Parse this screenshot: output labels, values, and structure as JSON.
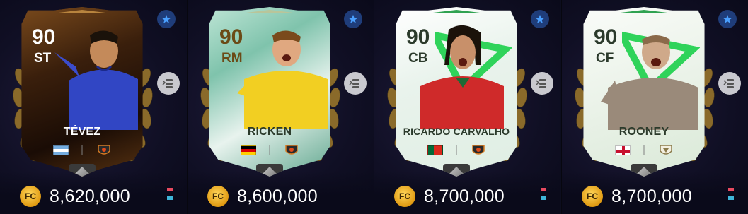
{
  "cards": [
    {
      "id": "tevez",
      "rating": "90",
      "position": "ST",
      "name": "TÉVEZ",
      "flag": "argentina",
      "club_badge": "club-badge-icon",
      "price": "8,620,000"
    },
    {
      "id": "ricken",
      "rating": "90",
      "position": "RM",
      "name": "RICKEN",
      "flag": "germany",
      "club_badge": "club-badge-icon",
      "price": "8,600,000"
    },
    {
      "id": "carvalho",
      "rating": "90",
      "position": "CB",
      "name": "RICARDO CARVALHO",
      "flag": "portugal",
      "club_badge": "club-badge-icon",
      "price": "8,700,000"
    },
    {
      "id": "rooney",
      "rating": "90",
      "position": "CF",
      "name": "ROONEY",
      "flag": "england",
      "club_badge": "club-badge-icon",
      "price": "8,700,000"
    }
  ],
  "icons": {
    "star_badge": "star-icon",
    "swap": "swap-icon",
    "coin": "fc-coin-icon",
    "trend": "price-trend-icon",
    "gem": "rank-gem-icon"
  },
  "colors": {
    "background": "#0c0d1e",
    "star_badge_bg": "#1f3d7a",
    "star_color": "#4aa0ff",
    "coin_gold": "#f0b12a",
    "trend_up": "#e84a5f",
    "trend_down": "#3fb6d9"
  }
}
